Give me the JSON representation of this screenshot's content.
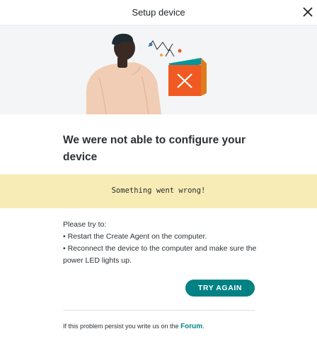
{
  "header": {
    "title": "Setup device"
  },
  "main": {
    "heading": "We were not able to configure your device",
    "error_message": "Something went wrong!",
    "instructions_intro": "Please try to:",
    "instructions": [
      "• Restart the Create Agent on the computer.",
      "• Reconnect the device to the computer and make sure the power LED lights up."
    ],
    "try_again_label": "TRY AGAIN"
  },
  "footer": {
    "text_before": "If this problem persist you write us on the ",
    "forum_link": "Forum",
    "text_after": "."
  },
  "colors": {
    "accent": "#008184",
    "banner": "#f7ecb6",
    "error_box": "#f05a22"
  }
}
